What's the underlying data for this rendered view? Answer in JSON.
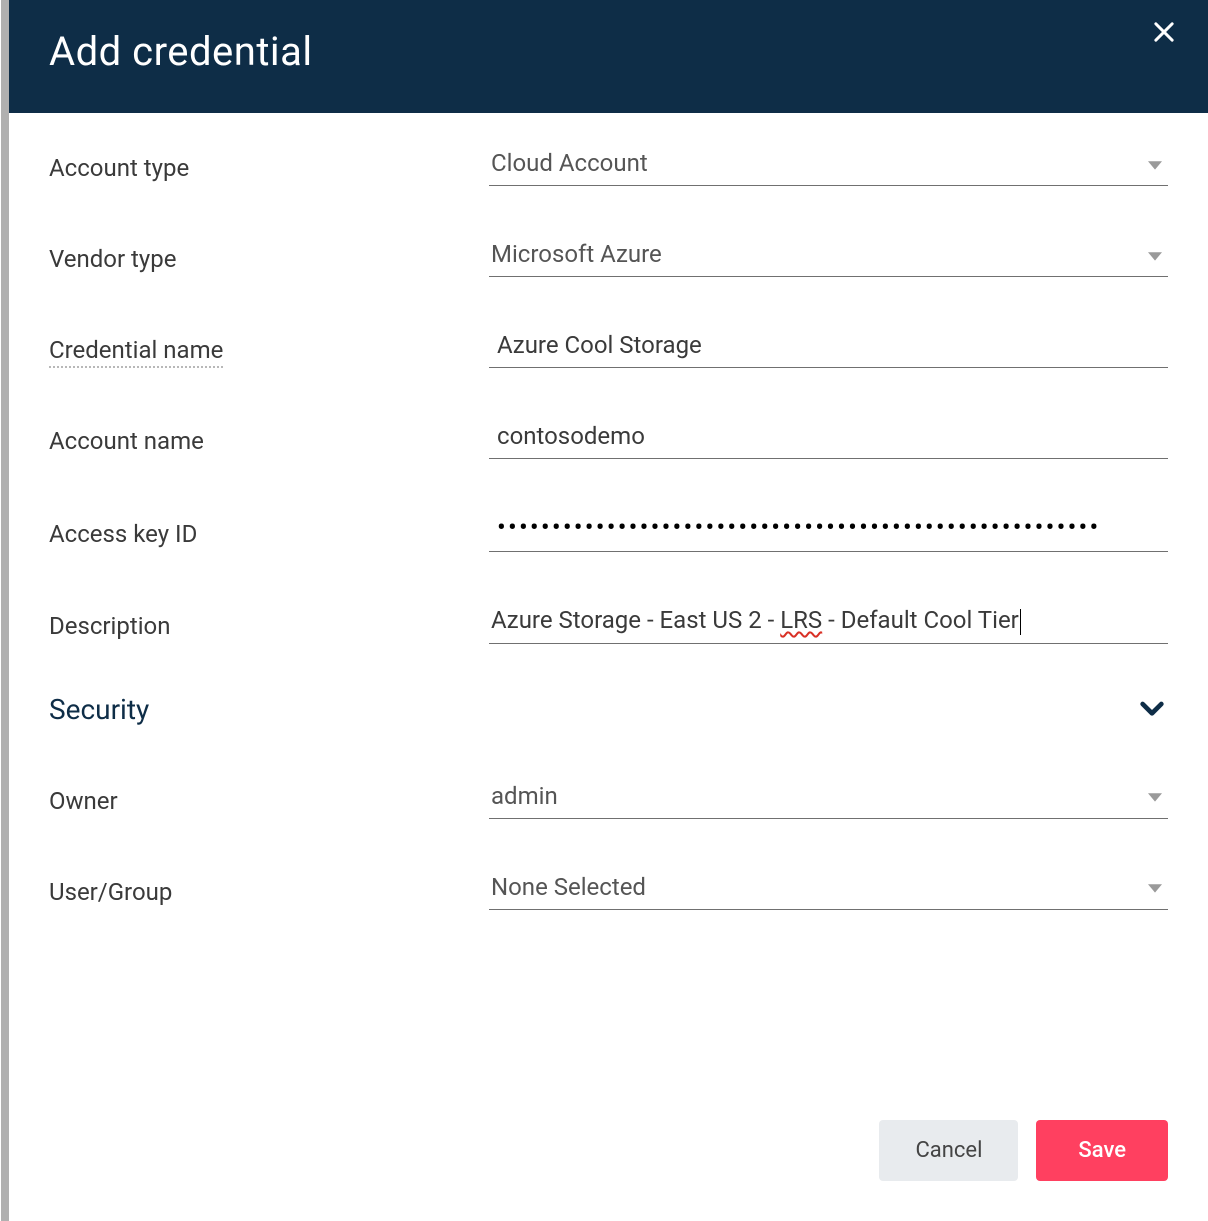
{
  "header": {
    "title": "Add credential"
  },
  "form": {
    "account_type": {
      "label": "Account type",
      "value": "Cloud Account"
    },
    "vendor_type": {
      "label": "Vendor type",
      "value": "Microsoft Azure"
    },
    "credential_name": {
      "label": "Credential name",
      "value": "Azure Cool Storage"
    },
    "account_name": {
      "label": "Account name",
      "value": "contosodemo"
    },
    "access_key": {
      "label": "Access key ID",
      "masked": "•••••••••••••••••••••••••••••••••••••••••••••••••••••••"
    },
    "description": {
      "label": "Description",
      "prefix": "Azure Storage - East US 2 - ",
      "spelled": "LRS",
      "suffix": " - Default Cool Tier",
      "value": "Azure Storage - East US 2 - LRS - Default Cool Tier"
    }
  },
  "section": {
    "security": {
      "title": "Security"
    },
    "owner": {
      "label": "Owner",
      "value": "admin"
    },
    "user_group": {
      "label": "User/Group",
      "value": "None Selected"
    }
  },
  "footer": {
    "cancel": "Cancel",
    "save": "Save"
  }
}
